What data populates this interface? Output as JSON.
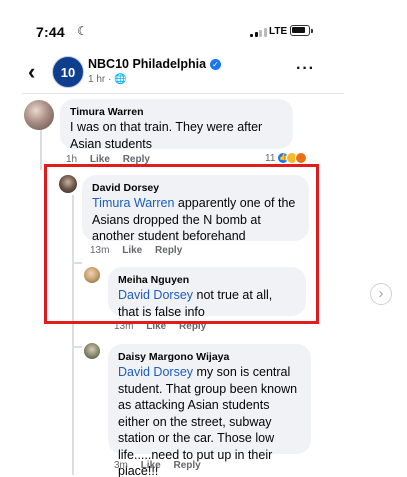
{
  "status_bar": {
    "time": "7:44",
    "network": "LTE"
  },
  "header": {
    "page_name": "NBC10 Philadelphia",
    "avatar_text": "10",
    "meta": "1 hr ·"
  },
  "comments": [
    {
      "author": "Timura Warren",
      "text": "I was on that train. They were after Asian students",
      "time": "1h",
      "like": "Like",
      "reply": "Reply",
      "reaction_count": "11"
    },
    {
      "author": "David Dorsey",
      "mention": "Timura Warren",
      "text": " apparently one of the Asians dropped the N bomb at another student beforehand",
      "time": "13m",
      "like": "Like",
      "reply": "Reply"
    },
    {
      "author": "Meiha Nguyen",
      "mention": "David Dorsey",
      "text": " not true at all, that is false info",
      "time": "13m",
      "like": "Like",
      "reply": "Reply"
    },
    {
      "author": "Daisy Margono Wijaya",
      "mention": "David Dorsey",
      "text": " my son is central student. That group been known as attacking Asian students either on the street, subway station or the car. Those low life.....need to put up in their place!!!",
      "time": "3m",
      "like": "Like",
      "reply": "Reply"
    }
  ],
  "colors": {
    "highlight": "#e21b1b",
    "mention": "#1b5dbf",
    "bubble": "#f0f2f5"
  }
}
